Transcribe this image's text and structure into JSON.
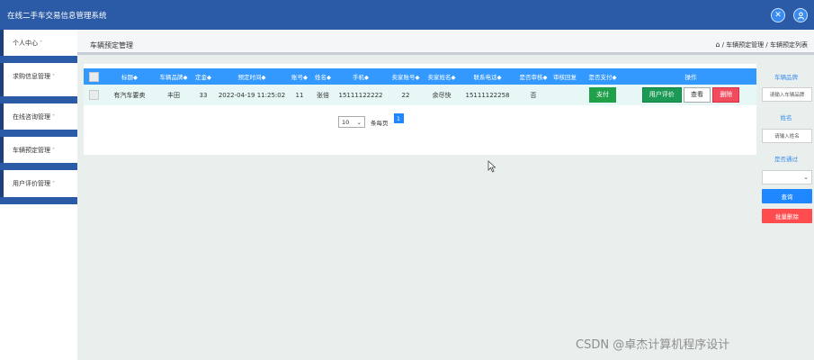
{
  "app": {
    "title": "在线二手车交易信息管理系统"
  },
  "topbar": {
    "tools_icon": "tools-icon",
    "user_icon": "user-icon"
  },
  "sidebar": {
    "items": [
      {
        "label": "个人中心"
      },
      {
        "label": "求购信息管理"
      },
      {
        "label": "在线咨询管理"
      },
      {
        "label": "车辆预定管理"
      },
      {
        "label": "用户评价管理"
      }
    ],
    "caret": "˅"
  },
  "header": {
    "page_title": "车辆预定管理",
    "breadcrumb": "/ 车辆预定管理 / 车辆预定列表"
  },
  "table": {
    "columns": [
      "标题",
      "车辆品牌",
      "定金",
      "预定时间",
      "账号",
      "姓名",
      "手机",
      "卖家账号",
      "卖家姓名",
      "联系电话",
      "是否审核",
      "审核回复",
      "是否支付",
      "操作"
    ],
    "sort_mark": "◆",
    "rows": [
      {
        "title": "有汽车要卖",
        "brand": "丰田",
        "deposit": "33",
        "time": "2022-04-19 11:25:02",
        "account": "11",
        "name": "张倍",
        "phone": "15111122222",
        "seller_account": "22",
        "seller_name": "余尽快",
        "seller_phone": "15111122258",
        "reviewed": "否",
        "reply": "",
        "pay_label": "支付",
        "actions": {
          "review": "用户评价",
          "view": "查看",
          "delete": "删除"
        }
      }
    ]
  },
  "pager": {
    "page_size": "10",
    "per_page_label": "条每页",
    "current_page": "1"
  },
  "search": {
    "brand_label": "车辆品牌",
    "brand_placeholder": "请输入车辆品牌",
    "name_label": "姓名",
    "name_placeholder": "请输入姓名",
    "approved_label": "是否通过",
    "approved_value": "",
    "query_button": "查询",
    "batch_delete_button": "批量删除"
  },
  "watermark": "CSDN @卓杰计算机程序设计"
}
